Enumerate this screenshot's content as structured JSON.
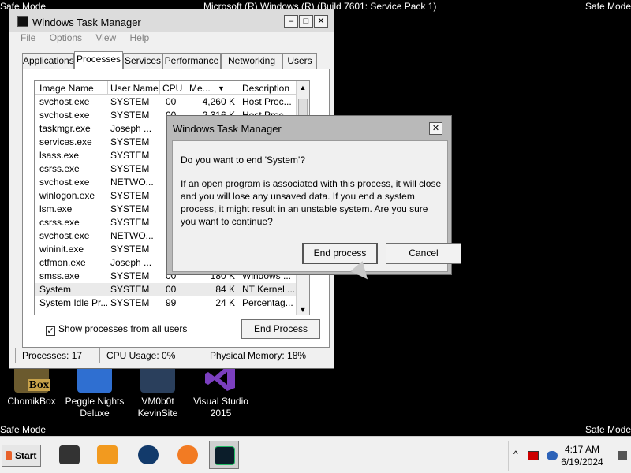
{
  "safe_mode": {
    "label": "Safe Mode"
  },
  "os_build": "Microsoft (R) Windows (R) (Build 7601: Service Pack 1)",
  "desktop_icons": [
    {
      "name": "ChomikBox",
      "icon": "chomikbox-icon",
      "badge": "Box"
    },
    {
      "name": "Peggle Nights Deluxe",
      "icon": "peggle-icon"
    },
    {
      "name": "VM0b0t KevinSite",
      "icon": "vm0b0t-icon"
    },
    {
      "name": "Visual Studio 2015",
      "icon": "visual-studio-icon"
    }
  ],
  "task_manager": {
    "title": "Windows Task Manager",
    "window_buttons": {
      "minimize": "–",
      "maximize": "□",
      "close": "✕"
    },
    "menu": [
      "File",
      "Options",
      "View",
      "Help"
    ],
    "tabs": [
      "Applications",
      "Processes",
      "Services",
      "Performance",
      "Networking",
      "Users"
    ],
    "active_tab": "Processes",
    "columns": [
      "Image Name",
      "User Name",
      "CPU",
      "Me...",
      "Description"
    ],
    "sort_indicator": "▼",
    "rows": [
      [
        "svchost.exe",
        "SYSTEM",
        "00",
        "4,260 K",
        "Host Proc..."
      ],
      [
        "svchost.exe",
        "SYSTEM",
        "00",
        "2,316 K",
        "Host Proc..."
      ],
      [
        "taskmgr.exe",
        "Joseph ...",
        "",
        "",
        ""
      ],
      [
        "services.exe",
        "SYSTEM",
        "",
        "",
        ""
      ],
      [
        "lsass.exe",
        "SYSTEM",
        "",
        "",
        ""
      ],
      [
        "csrss.exe",
        "SYSTEM",
        "",
        "",
        ""
      ],
      [
        "svchost.exe",
        "NETWO...",
        "",
        "",
        ""
      ],
      [
        "winlogon.exe",
        "SYSTEM",
        "",
        "",
        ""
      ],
      [
        "lsm.exe",
        "SYSTEM",
        "",
        "",
        ""
      ],
      [
        "csrss.exe",
        "SYSTEM",
        "",
        "",
        ""
      ],
      [
        "svchost.exe",
        "NETWO...",
        "",
        "",
        ""
      ],
      [
        "wininit.exe",
        "SYSTEM",
        "",
        "",
        ""
      ],
      [
        "ctfmon.exe",
        "Joseph ...",
        "",
        "",
        ""
      ],
      [
        "smss.exe",
        "SYSTEM",
        "00",
        "180 K",
        "Windows ..."
      ],
      [
        "System",
        "SYSTEM",
        "00",
        "84 K",
        "NT Kernel ..."
      ],
      [
        "System Idle Pr...",
        "SYSTEM",
        "99",
        "24 K",
        "Percentag..."
      ]
    ],
    "selected_row": 14,
    "show_all_label": "Show processes from all users",
    "show_all_checked": true,
    "end_process_label": "End Process",
    "status": {
      "processes": "Processes: 17",
      "cpu": "CPU Usage: 0%",
      "memory": "Physical Memory: 18%"
    }
  },
  "dialog": {
    "title": "Windows Task Manager",
    "close": "✕",
    "question": "Do you want to end 'System'?",
    "message": "If an open program is associated with this process, it will close and you will lose any unsaved data. If you end a system process, it might result in an unstable system. Are you sure you want to continue?",
    "confirm_label": "End process",
    "cancel_label": "Cancel"
  },
  "taskbar": {
    "start_label": "Start",
    "pinned": [
      "dvd-player-icon",
      "media-center-icon",
      "globe-icon",
      "firefox-icon",
      "task-manager-icon"
    ],
    "tray_chevron": "^",
    "time": "4:17 AM",
    "date": "6/19/2024"
  }
}
